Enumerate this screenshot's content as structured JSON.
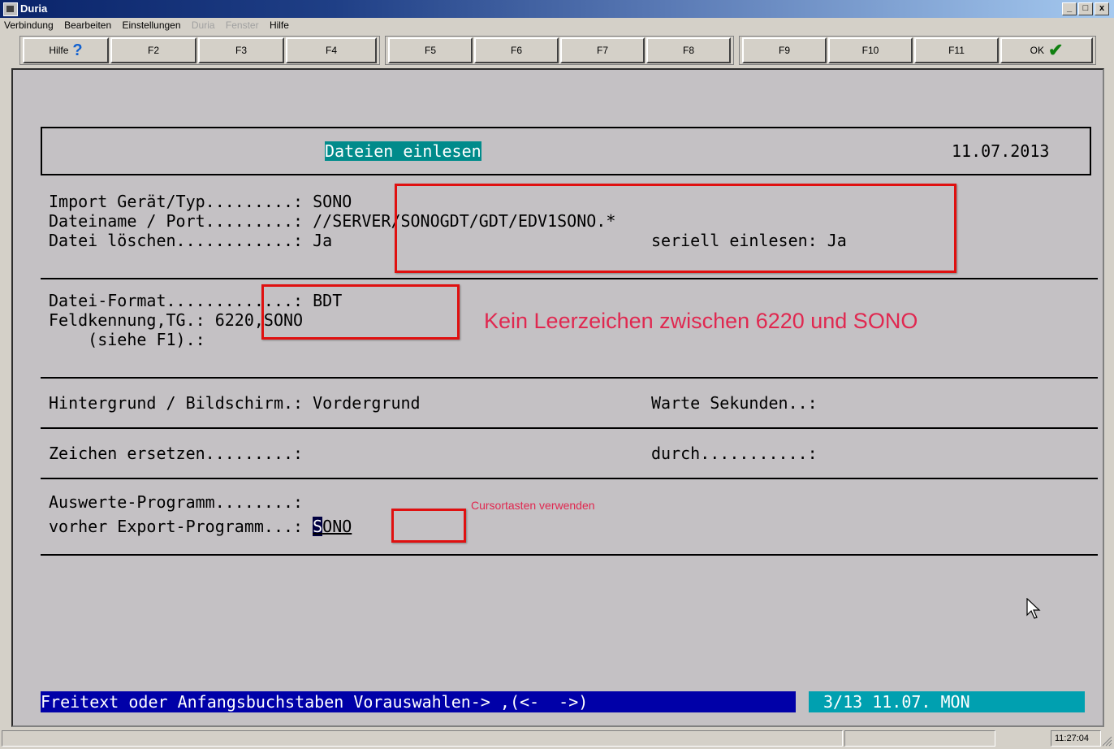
{
  "window": {
    "title": "Duria",
    "buttons": [
      "_",
      "□",
      "x"
    ]
  },
  "menu": [
    {
      "label": "Verbindung",
      "disabled": false
    },
    {
      "label": "Bearbeiten",
      "disabled": false
    },
    {
      "label": "Einstellungen",
      "disabled": false
    },
    {
      "label": "Duria",
      "disabled": true
    },
    {
      "label": "Fenster",
      "disabled": true
    },
    {
      "label": "Hilfe",
      "disabled": false
    }
  ],
  "toolbar": {
    "help": "Hilfe",
    "keys": [
      "F2",
      "F3",
      "F4",
      "F5",
      "F6",
      "F7",
      "F8",
      "F9",
      "F10",
      "F11"
    ],
    "ok": "OK"
  },
  "screen": {
    "title": "Dateien einlesen",
    "date": "11.07.2013",
    "import_label": "Import Gerät/Typ.........: ",
    "import_value": "SONO",
    "filename_label": "Dateiname / Port.........: ",
    "filename_value": "//SERVER/SONOGDT/GDT/EDV1SONO.*",
    "delete_label": "Datei löschen............: ",
    "delete_value": "Ja",
    "serial_label": "seriell einlesen: ",
    "serial_value": "Ja",
    "format_label": "Datei-Format.............: ",
    "format_value": "BDT",
    "feld_label": "Feldkennung,TG.: ",
    "feld_value": "6220,SONO",
    "siehe_label": "    (siehe F1).:",
    "annotation_main": "Kein Leerzeichen zwischen 6220 und SONO",
    "hinter_label": "Hintergrund / Bildschirm.: ",
    "hinter_value": "Vordergrund",
    "warte_label": "Warte Sekunden..:",
    "zeichen_label": "Zeichen ersetzen.........:",
    "durch_label": "durch...........:",
    "auswerte_label": "Auswerte-Programm........:",
    "vorher_label": "vorher Export-Programm...: ",
    "vorher_cursor_char": "S",
    "vorher_rest": "ONO",
    "annotation_cursor": "Cursortasten verwenden",
    "hint": "Freitext oder Anfangsbuchstaben Vorauswahlen-> ,(<-  ->)",
    "status": "3/13 11.07. MON"
  },
  "statusbar": {
    "time": "11:27:04"
  },
  "colors": {
    "highlight": "#008b8b",
    "hint_bg": "#0000a8",
    "status_bg": "#00a0b0",
    "annotation": "#e02850",
    "box": "#e01010"
  }
}
